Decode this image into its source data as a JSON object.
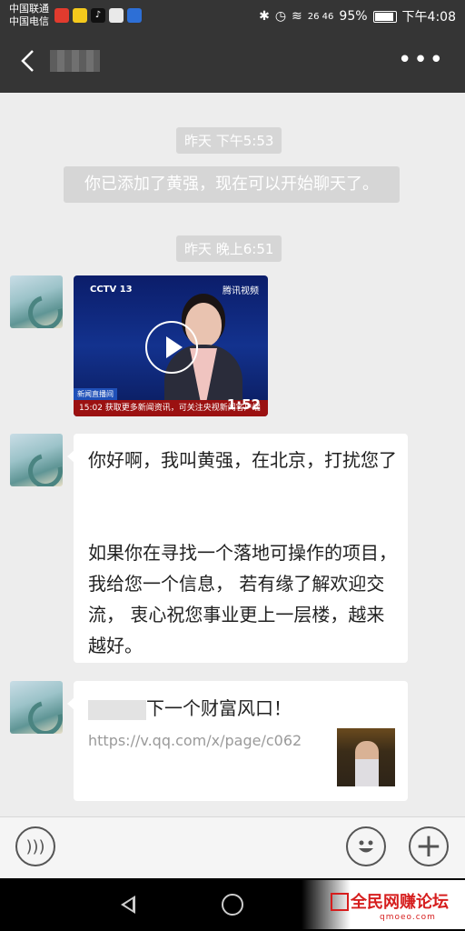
{
  "status": {
    "carrier1": "中国联通",
    "carrier2": "中国电信",
    "network": "26 46",
    "battery": "95%",
    "time": "下午4:08"
  },
  "header": {
    "more": "•••"
  },
  "chat": {
    "time1": "昨天 下午5:53",
    "system": "你已添加了黄强，现在可以开始聊天了。",
    "time2": "昨天 晚上6:51",
    "video": {
      "brand": "CCTV 13",
      "source": "腾讯视频",
      "duration": "1:52",
      "ticker": "15:02 获取更多新闻资讯，可关注央视新闻客户端",
      "tag": "新闻直播间"
    },
    "message_line1": "你好啊，我叫黄强，在北京，打扰您了",
    "message_line2": "如果你在寻找一个落地可操作的项目，我给您一个信息， 若有缘了解欢迎交流， 衷心祝您事业更上一层楼，越来越好。",
    "link": {
      "title": "下一个财富风口！",
      "url": "https://v.qq.com/x/page/c062"
    }
  },
  "watermark": {
    "text": "全民网赚论坛",
    "sub": "qmoeo.com"
  }
}
